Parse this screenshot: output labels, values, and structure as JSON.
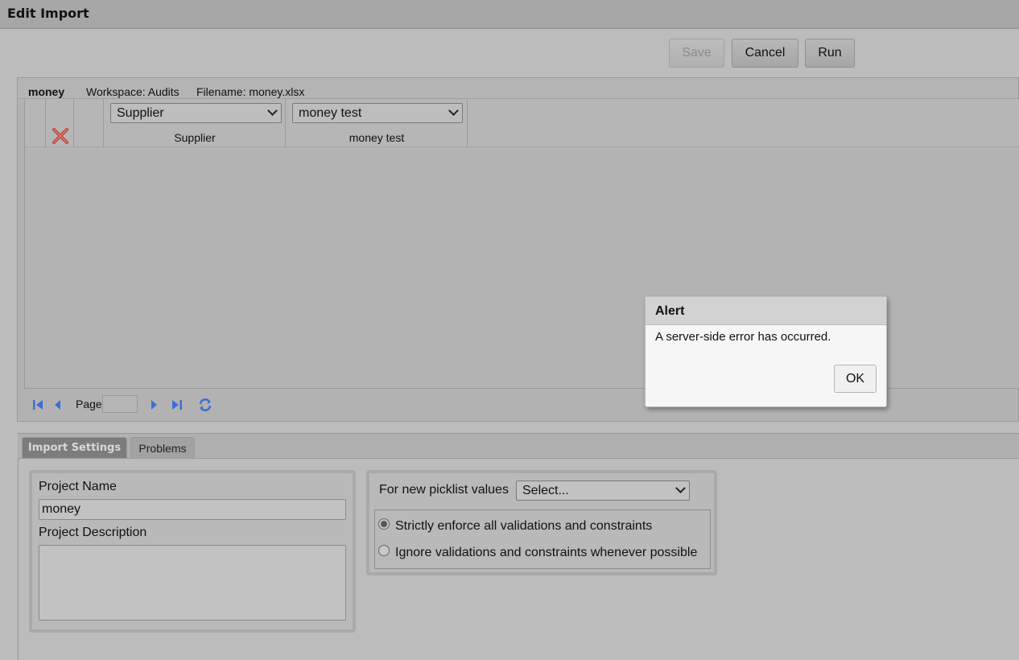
{
  "window": {
    "title": "Edit Import"
  },
  "toolbar": {
    "save_label": "Save",
    "cancel_label": "Cancel",
    "run_label": "Run"
  },
  "mapping": {
    "name": "money",
    "workspace": "Workspace: Audits",
    "filename": "Filename: money.xlsx",
    "columns": [
      {
        "selected": "Supplier",
        "caption": "Supplier"
      },
      {
        "selected": "money test",
        "caption": "money test"
      }
    ]
  },
  "pager": {
    "page_label": "Page",
    "page_value": ""
  },
  "tabs": [
    {
      "label": "Import Settings",
      "active": true
    },
    {
      "label": "Problems",
      "active": false
    }
  ],
  "settings": {
    "project_name_label": "Project Name",
    "project_name_value": "money",
    "project_description_label": "Project Description",
    "project_description_value": "",
    "picklist_label": "For new picklist values",
    "picklist_selected": "Select...",
    "options": [
      {
        "label": "Strictly enforce all validations and constraints",
        "checked": true
      },
      {
        "label": "Ignore validations and constraints whenever possible",
        "checked": false
      }
    ]
  },
  "alert": {
    "title": "Alert",
    "message": "A server-side error has occurred.",
    "ok_label": "OK"
  },
  "colors": {
    "accent_icon": "#3b6fd6",
    "delete_icon": "#c0392b"
  }
}
